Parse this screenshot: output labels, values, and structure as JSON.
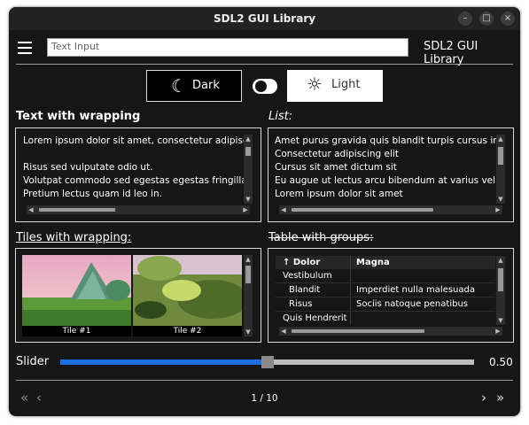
{
  "window": {
    "title": "SDL2 GUI Library"
  },
  "header": {
    "input_value": "Text Input",
    "app_name": "SDL2 GUI Library"
  },
  "theme": {
    "dark_label": "Dark",
    "light_label": "Light",
    "moon_icon": "☾",
    "sun_icon": "☼"
  },
  "sections": {
    "wrapping_title": "Text with wrapping",
    "list_title": "List:",
    "tiles_title": "Tiles with wrapping:",
    "table_title": "Table with groups:"
  },
  "wrapping_text": {
    "lines": [
      "Lorem ipsum dolor sit amet, consectetur adipiscing elit",
      "",
      "Risus sed vulputate odio ut.",
      "Volutpat commodo sed egestas egestas fringilla.",
      "Pretium lectus quam id leo in."
    ]
  },
  "list": {
    "items": [
      "Amet purus gravida quis blandit turpis cursus in hac",
      "Consectetur adipiscing elit",
      "Cursus sit amet dictum sit",
      "Eu augue ut lectus arcu bibendum at varius vel pharetra",
      "Lorem ipsum dolor sit amet"
    ]
  },
  "tiles": [
    {
      "caption": "Tile #1"
    },
    {
      "caption": "Tile #2"
    }
  ],
  "table": {
    "headers": [
      "↑ Dolor",
      "Magna"
    ],
    "rows": [
      {
        "col1": "Vestibulum",
        "col2": ""
      },
      {
        "col1": "Blandit",
        "col2": "Imperdiet nulla malesuada"
      },
      {
        "col1": "Risus",
        "col2": "Sociis natoque penatibus"
      },
      {
        "col1": "Quis Hendrerit",
        "col2": ""
      }
    ]
  },
  "slider": {
    "label": "Slider",
    "value": 0.5,
    "value_text": "0.50",
    "fill_color": "#1e6fe0"
  },
  "pagination": {
    "first_icon": "«",
    "prev_icon": "‹",
    "page_text": "1 / 10",
    "next_icon": "›",
    "last_icon": "»"
  },
  "window_buttons": {
    "minimize": "–",
    "maximize": "□",
    "close": "×"
  }
}
